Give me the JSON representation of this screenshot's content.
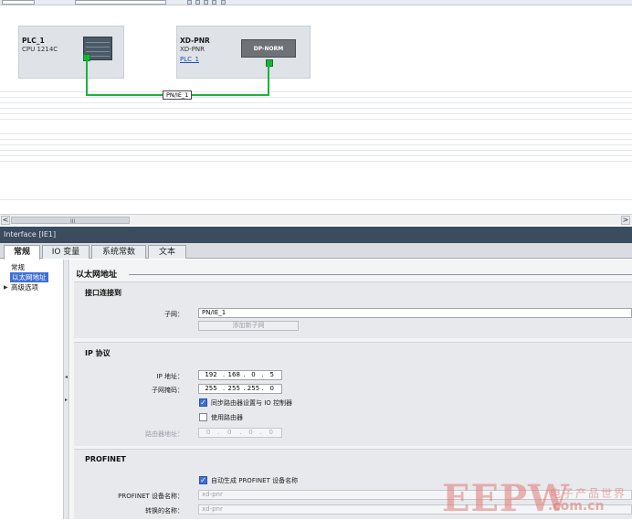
{
  "canvas": {
    "devices": [
      {
        "name": "PLC_1",
        "type": "CPU 1214C"
      },
      {
        "name": "XD-PNR",
        "type": "XD-PNR",
        "link": "PLC_1",
        "module_label": "DP-NORM"
      }
    ],
    "network_label": "PN/IE_1",
    "wire_color": "#19b43a"
  },
  "scrollbar": {
    "left_arrow": "<",
    "right_arrow": ">",
    "grip": "III"
  },
  "inspector": {
    "title": "Interface [IE1]",
    "tabs": [
      "常规",
      "IO 变量",
      "系统常数",
      "文本"
    ],
    "active_tab": "常规",
    "tree": [
      {
        "label": "常规"
      },
      {
        "label": "以太网地址",
        "selected": true
      },
      {
        "label": "高级选项",
        "expandable": true
      }
    ]
  },
  "content": {
    "section_title": "以太网地址",
    "interface_group": {
      "title": "接口连接到",
      "subnet_label": "子网：",
      "subnet_value": "PN/IE_1",
      "add_subnet_button": "添加新子网"
    },
    "ip_group": {
      "title": "IP 协议",
      "ip_label": "IP 地址：",
      "ip_value": [
        "192",
        "168",
        "0",
        "5"
      ],
      "mask_label": "子网掩码：",
      "mask_value": [
        "255",
        "255",
        "255",
        "0"
      ],
      "sync_router_label": "同步路由器设置与 IO 控制器",
      "sync_router_checked": true,
      "use_router_label": "使用路由器",
      "use_router_checked": false,
      "router_label": "路由器地址：",
      "router_value": [
        "0",
        "0",
        "0",
        "0"
      ]
    },
    "profinet_group": {
      "title": "PROFINET",
      "auto_name_label": "自动生成 PROFINET 设备名称",
      "auto_name_checked": true,
      "device_name_label": "PROFINET 设备名称：",
      "device_name_value": "xd-pnr",
      "converted_name_label": "转换的名称：",
      "converted_name_value": "xd-pnr"
    }
  },
  "watermark": {
    "text": "EEPW",
    "cn": "电子产品世界",
    "com": ".com.cn"
  }
}
